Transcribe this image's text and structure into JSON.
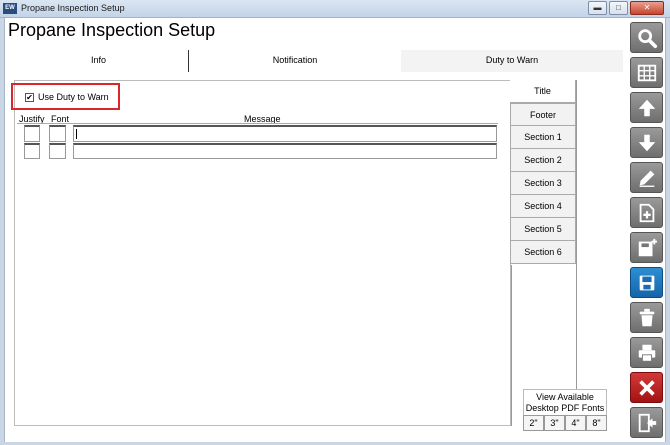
{
  "window": {
    "title": "Propane Inspection Setup",
    "app_icon_text": "EW",
    "minimize_label": "▬",
    "maximize_label": "□",
    "close_label": "✕"
  },
  "page_title": "Propane Inspection Setup",
  "tabs": [
    {
      "label": "Info",
      "active": false
    },
    {
      "label": "Notification",
      "active": false
    },
    {
      "label": "Duty to Warn",
      "active": true
    }
  ],
  "duty_to_warn": {
    "use_checkbox_label": "Use Duty to Warn",
    "use_checked": true,
    "check_mark": "✔",
    "columns": {
      "justify": "Justify",
      "font": "Font",
      "message": "Message"
    },
    "rows": [
      {
        "justify": "",
        "font": "",
        "message": ""
      },
      {
        "justify": "",
        "font": "",
        "message": ""
      }
    ]
  },
  "sections": [
    {
      "label": "Title",
      "selected": true
    },
    {
      "label": "Footer",
      "selected": false
    },
    {
      "label": "Section 1",
      "selected": false
    },
    {
      "label": "Section 2",
      "selected": false
    },
    {
      "label": "Section 3",
      "selected": false
    },
    {
      "label": "Section 4",
      "selected": false
    },
    {
      "label": "Section 5",
      "selected": false
    },
    {
      "label": "Section 6",
      "selected": false
    }
  ],
  "pdf_fonts": {
    "title_line1": "View Available",
    "title_line2": "Desktop PDF Fonts",
    "sizes": [
      "2\"",
      "3\"",
      "4\"",
      "8\""
    ]
  },
  "toolbar_icons": [
    "search-icon",
    "grid-icon",
    "arrow-up-icon",
    "arrow-down-icon",
    "pencil-icon",
    "new-document-icon",
    "save-new-icon",
    "save-icon",
    "trash-icon",
    "print-icon",
    "cancel-icon",
    "exit-icon"
  ]
}
